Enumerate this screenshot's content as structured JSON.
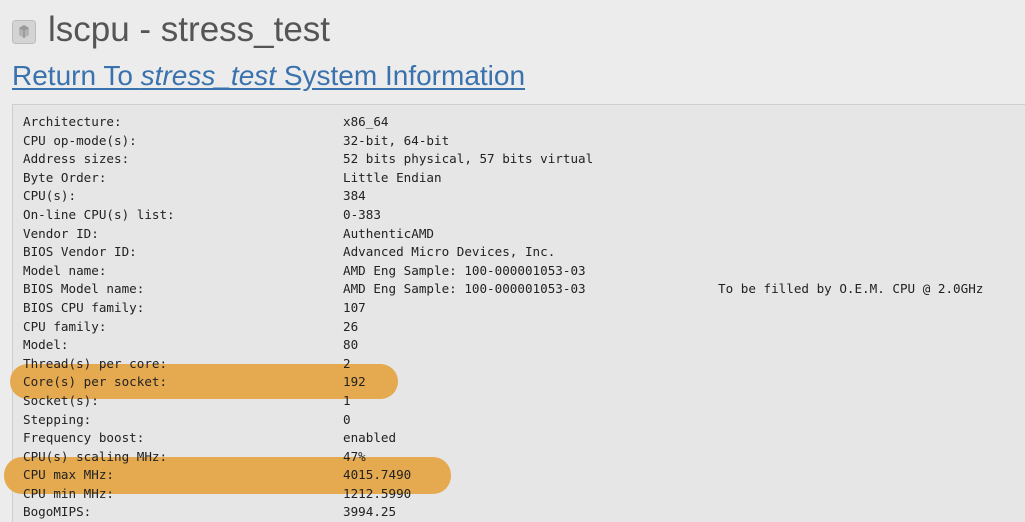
{
  "header": {
    "icon": "package-icon",
    "title": "lscpu - stress_test"
  },
  "return_link": {
    "prefix": "Return To ",
    "system": "stress_test",
    "suffix": " System Information"
  },
  "highlight_color": "#e5a747",
  "rows": [
    {
      "label": "Architecture:",
      "value": "x86_64"
    },
    {
      "label": "CPU op-mode(s):",
      "value": "32-bit, 64-bit"
    },
    {
      "label": "Address sizes:",
      "value": "52 bits physical, 57 bits virtual"
    },
    {
      "label": "Byte Order:",
      "value": "Little Endian"
    },
    {
      "label": "CPU(s):",
      "value": "384"
    },
    {
      "label": "On-line CPU(s) list:",
      "value": "0-383"
    },
    {
      "label": "Vendor ID:",
      "value": "AuthenticAMD"
    },
    {
      "label": "BIOS Vendor ID:",
      "value": "Advanced Micro Devices, Inc."
    },
    {
      "label": "Model name:",
      "value": "AMD Eng Sample: 100-000001053-03"
    },
    {
      "label": "BIOS Model name:",
      "value": "AMD Eng Sample: 100-000001053-03",
      "extra": "To be filled by O.E.M. CPU @ 2.0GHz"
    },
    {
      "label": "BIOS CPU family:",
      "value": "107"
    },
    {
      "label": "CPU family:",
      "value": "26"
    },
    {
      "label": "Model:",
      "value": "80"
    },
    {
      "label": "Thread(s) per core:",
      "value": "2"
    },
    {
      "label": "Core(s) per socket:",
      "value": "192"
    },
    {
      "label": "Socket(s):",
      "value": "1"
    },
    {
      "label": "Stepping:",
      "value": "0"
    },
    {
      "label": "Frequency boost:",
      "value": "enabled"
    },
    {
      "label": "CPU(s) scaling MHz:",
      "value": "47%"
    },
    {
      "label": "CPU max MHz:",
      "value": "4015.7490"
    },
    {
      "label": "CPU min MHz:",
      "value": "1212.5990"
    },
    {
      "label": "BogoMIPS:",
      "value": "3994.25"
    }
  ]
}
